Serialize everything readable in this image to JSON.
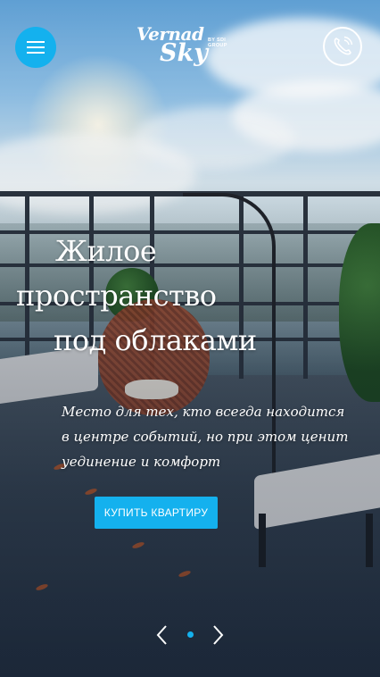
{
  "header": {
    "menu_icon": "hamburger-icon",
    "logo": {
      "line1": "Vernad",
      "line2": "Sky",
      "tagline": "BY SDI GROUP"
    },
    "phone_icon": "phone-icon"
  },
  "hero": {
    "title_lines": [
      "Жилое",
      "пространство",
      "под облаками"
    ],
    "subtitle_lines": [
      "Место для тех, кто всегда находится",
      "в центре событий, но при этом ценит",
      "уединение и комфорт"
    ],
    "cta_label": "КУПИТЬ КВАРТИРУ"
  },
  "slider": {
    "prev_icon": "chevron-left-icon",
    "next_icon": "chevron-right-icon",
    "active_dot_color": "#14b1ee"
  },
  "colors": {
    "accent": "#14b1ee",
    "text": "#ffffff"
  }
}
